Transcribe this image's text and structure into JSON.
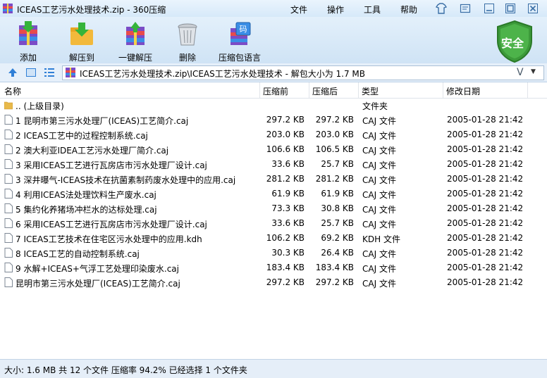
{
  "app": {
    "title": "ICEAS工艺污水处理技术.zip - 360压缩",
    "menu": [
      "文件",
      "操作",
      "工具",
      "帮助"
    ],
    "safety_badge": "安全"
  },
  "toolbar": {
    "buttons": [
      {
        "label": "添加",
        "icon": "add-books-icon"
      },
      {
        "label": "解压到",
        "icon": "extract-to-icon"
      },
      {
        "label": "一键解压",
        "icon": "one-click-extract-icon"
      },
      {
        "label": "删除",
        "icon": "trash-icon"
      },
      {
        "label": "压缩包语言",
        "icon": "archive-language-icon"
      }
    ]
  },
  "address": {
    "path": "ICEAS工艺污水处理技术.zip\\ICEAS工艺污水处理技术 - 解包大小为 1.7 MB",
    "v_mark": "V"
  },
  "columns": {
    "name": "名称",
    "size": "压缩前",
    "packed": "压缩后",
    "type": "类型",
    "modified": "修改日期"
  },
  "parent_dir": {
    "name": ".. (上级目录)",
    "type": "文件夹"
  },
  "files": [
    {
      "name": "1 昆明市第三污水处理厂(ICEAS)工艺简介.caj",
      "size": "297.2 KB",
      "packed": "297.2 KB",
      "type": "CAJ 文件",
      "modified": "2005-01-28 21:42"
    },
    {
      "name": "2 ICEAS工艺中的过程控制系统.caj",
      "size": "203.0 KB",
      "packed": "203.0 KB",
      "type": "CAJ 文件",
      "modified": "2005-01-28 21:42"
    },
    {
      "name": "2 澳大利亚IDEA工艺污水处理厂简介.caj",
      "size": "106.6 KB",
      "packed": "106.5 KB",
      "type": "CAJ 文件",
      "modified": "2005-01-28 21:42"
    },
    {
      "name": "3 采用ICEAS工艺进行瓦房店市污水处理厂设计.caj",
      "size": "33.6 KB",
      "packed": "25.7 KB",
      "type": "CAJ 文件",
      "modified": "2005-01-28 21:42"
    },
    {
      "name": "3 深井曝气-ICEAS技术在抗菌素制药废水处理中的应用.caj",
      "size": "281.2 KB",
      "packed": "281.2 KB",
      "type": "CAJ 文件",
      "modified": "2005-01-28 21:42"
    },
    {
      "name": "4 利用ICEAS法处理饮料生产废水.caj",
      "size": "61.9 KB",
      "packed": "61.9 KB",
      "type": "CAJ 文件",
      "modified": "2005-01-28 21:42"
    },
    {
      "name": "5 集约化养猪场冲栏水的达标处理.caj",
      "size": "73.3 KB",
      "packed": "30.8 KB",
      "type": "CAJ 文件",
      "modified": "2005-01-28 21:42"
    },
    {
      "name": "6 采用ICEAS工艺进行瓦房店市污水处理厂设计.caj",
      "size": "33.6 KB",
      "packed": "25.7 KB",
      "type": "CAJ 文件",
      "modified": "2005-01-28 21:42"
    },
    {
      "name": "7 ICEAS工艺技术在住宅区污水处理中的应用.kdh",
      "size": "106.2 KB",
      "packed": "69.2 KB",
      "type": "KDH 文件",
      "modified": "2005-01-28 21:42"
    },
    {
      "name": "8 ICEAS工艺的自动控制系统.caj",
      "size": "30.3 KB",
      "packed": "26.4 KB",
      "type": "CAJ 文件",
      "modified": "2005-01-28 21:42"
    },
    {
      "name": "9 水解+ICEAS+气浮工艺处理印染废水.caj",
      "size": "183.4 KB",
      "packed": "183.4 KB",
      "type": "CAJ 文件",
      "modified": "2005-01-28 21:42"
    },
    {
      "name": "昆明市第三污水处理厂(ICEAS)工艺简介.caj",
      "size": "297.2 KB",
      "packed": "297.2 KB",
      "type": "CAJ 文件",
      "modified": "2005-01-28 21:42"
    }
  ],
  "status": {
    "text": "大小: 1.6 MB 共 12 个文件 压缩率 94.2% 已经选择 1 个文件夹"
  },
  "colors": {
    "titlebar": "#d6e9f9",
    "toolbar": "#cfe3f5",
    "shield": "#3c9a3a",
    "folder": "#e8b94a"
  }
}
